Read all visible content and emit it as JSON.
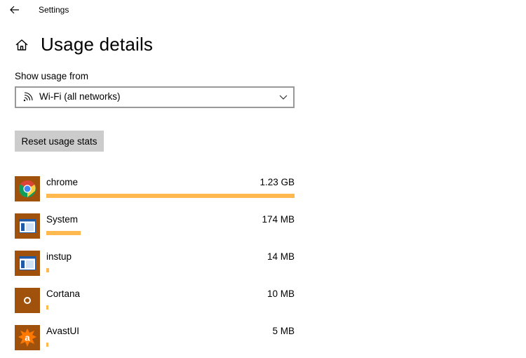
{
  "window": {
    "title": "Settings"
  },
  "header": {
    "title": "Usage details"
  },
  "filter": {
    "label": "Show usage from",
    "selected": "Wi-Fi (all networks)"
  },
  "actions": {
    "reset_label": "Reset usage stats"
  },
  "colors": {
    "usage_bar": "#ffb94f",
    "icon_bg": "#a0520d",
    "button_bg": "#cccccc",
    "select_border": "#999999"
  },
  "apps": [
    {
      "name": "chrome",
      "size": "1.23 GB",
      "usage_fraction": 1.0,
      "icon": "chrome-icon"
    },
    {
      "name": "System",
      "size": "174 MB",
      "usage_fraction": 0.139,
      "icon": "system-window-icon"
    },
    {
      "name": "instup",
      "size": "14 MB",
      "usage_fraction": 0.011,
      "icon": "installer-window-icon"
    },
    {
      "name": "Cortana",
      "size": "10 MB",
      "usage_fraction": 0.008,
      "icon": "cortana-icon"
    },
    {
      "name": "AvastUI",
      "size": "5 MB",
      "usage_fraction": 0.004,
      "icon": "avast-icon"
    }
  ]
}
